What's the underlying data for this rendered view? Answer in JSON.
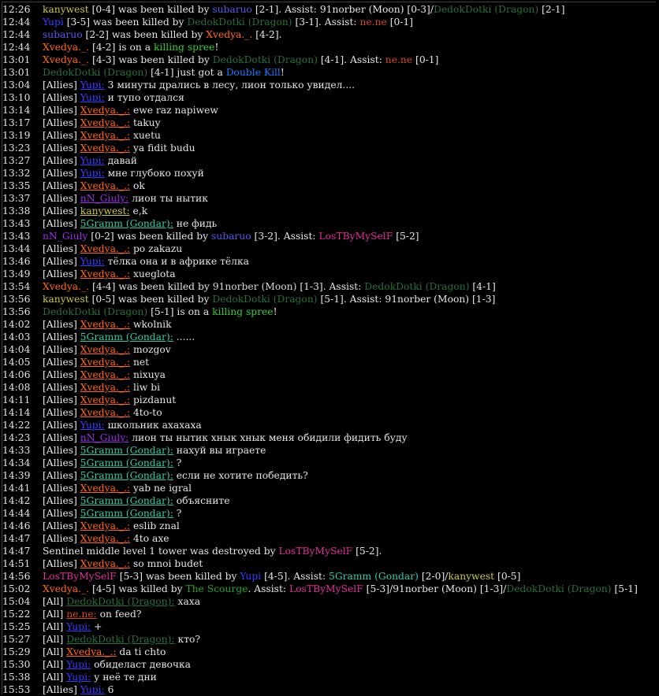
{
  "colors": {
    "white": "#e4e4e4",
    "kanywest": "#c8c850",
    "subaruo": "#5a5ae6",
    "Yupi": "#3c3cff",
    "nene": "#d04a1e",
    "Xvedya": "#ff6a1a",
    "Dedok": "#2a6e3a",
    "spree": "#3ec83e",
    "lime": "#64ff64",
    "doublekill": "#1a7aff",
    "nN": "#9a2ee6",
    "gramm": "#3ac8a8",
    "lost": "#e0309a",
    "scourge": "#2aa02a",
    "norber": "#d8d8d8"
  },
  "lines": [
    {
      "time": "12:26",
      "segs": [
        [
          "kanywest",
          "kanywest"
        ],
        [
          "white",
          " [0-4] was been killed by "
        ],
        [
          "subaruo",
          "subaruo"
        ],
        [
          "white",
          " [2-1]. Assist: 91norber (Moon) [0-3]/"
        ],
        [
          "Dedok",
          "DedokDotki (Dragon)"
        ],
        [
          "white",
          " [2-1]"
        ]
      ]
    },
    {
      "time": "12:44",
      "segs": [
        [
          "Yupi",
          "Yupi"
        ],
        [
          "white",
          " [3-5] was been killed by "
        ],
        [
          "Dedok",
          "DedokDotki (Dragon)"
        ],
        [
          "white",
          " [3-1]. Assist: "
        ],
        [
          "nene",
          "ne.ne"
        ],
        [
          "white",
          " [0-1]"
        ]
      ]
    },
    {
      "time": "12:44",
      "segs": [
        [
          "subaruo",
          "subaruo"
        ],
        [
          "white",
          " [2-2] was been killed by "
        ],
        [
          "Xvedya",
          "Xvedya._."
        ],
        [
          "white",
          " [4-2]."
        ]
      ]
    },
    {
      "time": "12:44",
      "segs": [
        [
          "Xvedya",
          "Xvedya._."
        ],
        [
          "white",
          " [4-2] is on a "
        ],
        [
          "spree",
          "killing spree"
        ],
        [
          "white",
          "!"
        ]
      ]
    },
    {
      "time": "13:01",
      "segs": [
        [
          "Xvedya",
          "Xvedya._."
        ],
        [
          "white",
          " [4-3] was been killed by "
        ],
        [
          "Dedok",
          "DedokDotki (Dragon)"
        ],
        [
          "white",
          " [4-1]. Assist: "
        ],
        [
          "nene",
          "ne.ne"
        ],
        [
          "white",
          " [0-1]"
        ]
      ]
    },
    {
      "time": "13:01",
      "segs": [
        [
          "Dedok",
          "DedokDotki (Dragon)"
        ],
        [
          "white",
          " [4-1] just got a "
        ],
        [
          "doublekill",
          "Double Kill"
        ],
        [
          "white",
          "!"
        ]
      ]
    },
    {
      "time": "13:04",
      "segs": [
        [
          "white",
          "[Allies] "
        ],
        [
          "Yupi",
          "Yupi:",
          "u"
        ],
        [
          "white",
          " 3 минуты дрались в лесу, лион только увидел...."
        ]
      ]
    },
    {
      "time": "13:10",
      "segs": [
        [
          "white",
          "[Allies] "
        ],
        [
          "Yupi",
          "Yupi:",
          "u"
        ],
        [
          "white",
          " и тупо отдался"
        ]
      ]
    },
    {
      "time": "13:14",
      "segs": [
        [
          "white",
          "[Allies] "
        ],
        [
          "Xvedya",
          "Xvedya._.:",
          "u"
        ],
        [
          "white",
          " ewe raz napiwew"
        ]
      ]
    },
    {
      "time": "13:17",
      "segs": [
        [
          "white",
          "[Allies] "
        ],
        [
          "Xvedya",
          "Xvedya._.:",
          "u"
        ],
        [
          "white",
          " takuy"
        ]
      ]
    },
    {
      "time": "13:19",
      "segs": [
        [
          "white",
          "[Allies] "
        ],
        [
          "Xvedya",
          "Xvedya._.:",
          "u"
        ],
        [
          "white",
          " xuetu"
        ]
      ]
    },
    {
      "time": "13:23",
      "segs": [
        [
          "white",
          "[Allies] "
        ],
        [
          "Xvedya",
          "Xvedya._.:",
          "u"
        ],
        [
          "white",
          " ya fidit budu"
        ]
      ]
    },
    {
      "time": "13:27",
      "segs": [
        [
          "white",
          "[Allies] "
        ],
        [
          "Yupi",
          "Yupi:",
          "u"
        ],
        [
          "white",
          " давай"
        ]
      ]
    },
    {
      "time": "13:32",
      "segs": [
        [
          "white",
          "[Allies] "
        ],
        [
          "Yupi",
          "Yupi:",
          "u"
        ],
        [
          "white",
          " мне глубоко похуй"
        ]
      ]
    },
    {
      "time": "13:35",
      "segs": [
        [
          "white",
          "[Allies] "
        ],
        [
          "Xvedya",
          "Xvedya._.:",
          "u"
        ],
        [
          "white",
          " ok"
        ]
      ]
    },
    {
      "time": "13:37",
      "segs": [
        [
          "white",
          "[Allies] "
        ],
        [
          "nN",
          "nN_Giuly:",
          "u"
        ],
        [
          "white",
          " лион ты нытик"
        ]
      ]
    },
    {
      "time": "13:38",
      "segs": [
        [
          "white",
          "[Allies] "
        ],
        [
          "kanywest",
          "kanywest:",
          "u"
        ],
        [
          "white",
          " e,k"
        ]
      ]
    },
    {
      "time": "13:43",
      "segs": [
        [
          "white",
          "[Allies] "
        ],
        [
          "gramm",
          "5Gramm (Gondar):",
          "u"
        ],
        [
          "white",
          " не фидь"
        ]
      ]
    },
    {
      "time": "13:43",
      "segs": [
        [
          "nN",
          "nN_Giuly"
        ],
        [
          "white",
          " [0-2] was been killed by "
        ],
        [
          "subaruo",
          "subaruo"
        ],
        [
          "white",
          " [3-2]. Assist: "
        ],
        [
          "lost",
          "LosTByMySelF"
        ],
        [
          "white",
          " [5-2]"
        ]
      ]
    },
    {
      "time": "13:44",
      "segs": [
        [
          "white",
          "[Allies] "
        ],
        [
          "Xvedya",
          "Xvedya._.:",
          "u"
        ],
        [
          "white",
          " po zakazu"
        ]
      ]
    },
    {
      "time": "13:46",
      "segs": [
        [
          "white",
          "[Allies] "
        ],
        [
          "Yupi",
          "Yupi:",
          "u"
        ],
        [
          "white",
          " тёлка она и в африке тёлка"
        ]
      ]
    },
    {
      "time": "13:49",
      "segs": [
        [
          "white",
          "[Allies] "
        ],
        [
          "Xvedya",
          "Xvedya._.:",
          "u"
        ],
        [
          "white",
          " xueglota"
        ]
      ]
    },
    {
      "time": "13:54",
      "segs": [
        [
          "Xvedya",
          "Xvedya._."
        ],
        [
          "white",
          " [4-4] was been killed by "
        ],
        [
          "norber",
          "91norber (Moon)"
        ],
        [
          "white",
          " [1-3]. Assist: "
        ],
        [
          "Dedok",
          "DedokDotki (Dragon)"
        ],
        [
          "white",
          " [4-1]"
        ]
      ]
    },
    {
      "time": "13:56",
      "segs": [
        [
          "kanywest",
          "kanywest"
        ],
        [
          "white",
          " [0-5] was been killed by "
        ],
        [
          "Dedok",
          "DedokDotki (Dragon)"
        ],
        [
          "white",
          " [5-1]. Assist: 91norber (Moon) [1-3]"
        ]
      ]
    },
    {
      "time": "13:56",
      "segs": [
        [
          "Dedok",
          "DedokDotki (Dragon)"
        ],
        [
          "white",
          " [5-1] is on a "
        ],
        [
          "spree",
          "killing spree"
        ],
        [
          "white",
          "!"
        ]
      ]
    },
    {
      "time": "14:02",
      "segs": [
        [
          "white",
          "[Allies] "
        ],
        [
          "Xvedya",
          "Xvedya._.:",
          "u"
        ],
        [
          "white",
          " wkolnik"
        ]
      ]
    },
    {
      "time": "14:03",
      "segs": [
        [
          "white",
          "[Allies] "
        ],
        [
          "gramm",
          "5Gramm (Gondar):",
          "u"
        ],
        [
          "white",
          " ......"
        ]
      ]
    },
    {
      "time": "14:04",
      "segs": [
        [
          "white",
          "[Allies] "
        ],
        [
          "Xvedya",
          "Xvedya._.:",
          "u"
        ],
        [
          "white",
          " mozgov"
        ]
      ]
    },
    {
      "time": "14:05",
      "segs": [
        [
          "white",
          "[Allies] "
        ],
        [
          "Xvedya",
          "Xvedya._.:",
          "u"
        ],
        [
          "white",
          " net"
        ]
      ]
    },
    {
      "time": "14:06",
      "segs": [
        [
          "white",
          "[Allies] "
        ],
        [
          "Xvedya",
          "Xvedya._.:",
          "u"
        ],
        [
          "white",
          " nixuya"
        ]
      ]
    },
    {
      "time": "14:08",
      "segs": [
        [
          "white",
          "[Allies] "
        ],
        [
          "Xvedya",
          "Xvedya._.:",
          "u"
        ],
        [
          "white",
          " liw bi"
        ]
      ]
    },
    {
      "time": "14:11",
      "segs": [
        [
          "white",
          "[Allies] "
        ],
        [
          "Xvedya",
          "Xvedya._.:",
          "u"
        ],
        [
          "white",
          " pizdanut"
        ]
      ]
    },
    {
      "time": "14:14",
      "segs": [
        [
          "white",
          "[Allies] "
        ],
        [
          "Xvedya",
          "Xvedya._.:",
          "u"
        ],
        [
          "white",
          " 4to-to"
        ]
      ]
    },
    {
      "time": "14:22",
      "segs": [
        [
          "white",
          "[Allies] "
        ],
        [
          "Yupi",
          "Yupi:",
          "u"
        ],
        [
          "white",
          " школьник ахахаха"
        ]
      ]
    },
    {
      "time": "14:23",
      "segs": [
        [
          "white",
          "[Allies] "
        ],
        [
          "nN",
          "nN_Giuly:",
          "u"
        ],
        [
          "white",
          " лион ты нытик хнык хнык меня обидили фидить буду"
        ]
      ]
    },
    {
      "time": "14:33",
      "segs": [
        [
          "white",
          "[Allies] "
        ],
        [
          "gramm",
          "5Gramm (Gondar):",
          "u"
        ],
        [
          "white",
          " нахуй вы играете"
        ]
      ]
    },
    {
      "time": "14:34",
      "segs": [
        [
          "white",
          "[Allies] "
        ],
        [
          "gramm",
          "5Gramm (Gondar):",
          "u"
        ],
        [
          "white",
          " ?"
        ]
      ]
    },
    {
      "time": "14:39",
      "segs": [
        [
          "white",
          "[Allies] "
        ],
        [
          "gramm",
          "5Gramm (Gondar):",
          "u"
        ],
        [
          "white",
          " если не хотите победить?"
        ]
      ]
    },
    {
      "time": "14:41",
      "segs": [
        [
          "white",
          "[Allies] "
        ],
        [
          "Xvedya",
          "Xvedya._.:",
          "u"
        ],
        [
          "white",
          " yab ne igral"
        ]
      ]
    },
    {
      "time": "14:42",
      "segs": [
        [
          "white",
          "[Allies] "
        ],
        [
          "gramm",
          "5Gramm (Gondar):",
          "u"
        ],
        [
          "white",
          " объясните"
        ]
      ]
    },
    {
      "time": "14:44",
      "segs": [
        [
          "white",
          "[Allies] "
        ],
        [
          "gramm",
          "5Gramm (Gondar):",
          "u"
        ],
        [
          "white",
          " ?"
        ]
      ]
    },
    {
      "time": "14:46",
      "segs": [
        [
          "white",
          "[Allies] "
        ],
        [
          "Xvedya",
          "Xvedya._.:",
          "u"
        ],
        [
          "white",
          " eslib znal"
        ]
      ]
    },
    {
      "time": "14:47",
      "segs": [
        [
          "white",
          "[Allies] "
        ],
        [
          "Xvedya",
          "Xvedya._.:",
          "u"
        ],
        [
          "white",
          " 4to axe"
        ]
      ]
    },
    {
      "time": "14:47",
      "segs": [
        [
          "white",
          "Sentinel middle level 1 tower was destroyed by "
        ],
        [
          "lost",
          "LosTByMySelF"
        ],
        [
          "white",
          " [5-2]."
        ]
      ]
    },
    {
      "time": "14:51",
      "segs": [
        [
          "white",
          "[Allies] "
        ],
        [
          "Xvedya",
          "Xvedya._.:",
          "u"
        ],
        [
          "white",
          " so mnoi budet"
        ]
      ]
    },
    {
      "time": "14:56",
      "segs": [
        [
          "lost",
          "LosTByMySelF"
        ],
        [
          "white",
          " [5-3] was been killed by "
        ],
        [
          "Yupi",
          "Yupi"
        ],
        [
          "white",
          " [4-5]. Assist: "
        ],
        [
          "gramm",
          "5Gramm (Gondar)"
        ],
        [
          "white",
          " [2-0]/"
        ],
        [
          "kanywest",
          "kanywest"
        ],
        [
          "white",
          " [0-5]"
        ]
      ]
    },
    {
      "time": "15:02",
      "segs": [
        [
          "Xvedya",
          "Xvedya._."
        ],
        [
          "white",
          " [4-5] was killed by "
        ],
        [
          "scourge",
          "The Scourge"
        ],
        [
          "white",
          ". Assist: "
        ],
        [
          "lost",
          "LosTByMySelF"
        ],
        [
          "white",
          " [5-3]/91norber (Moon) [1-3]/"
        ],
        [
          "Dedok",
          "DedokDotki (Dragon)"
        ],
        [
          "white",
          " [5-1]"
        ]
      ]
    },
    {
      "time": "15:04",
      "segs": [
        [
          "white",
          "[All] "
        ],
        [
          "Dedok",
          "DedokDotki (Dragon):",
          "u"
        ],
        [
          "white",
          " хаха"
        ]
      ]
    },
    {
      "time": "15:22",
      "segs": [
        [
          "white",
          "[All] "
        ],
        [
          "nene",
          "ne.ne:",
          "u"
        ],
        [
          "white",
          " on feed?"
        ]
      ]
    },
    {
      "time": "15:25",
      "segs": [
        [
          "white",
          "[All] "
        ],
        [
          "Yupi",
          "Yupi:",
          "u"
        ],
        [
          "white",
          " +"
        ]
      ]
    },
    {
      "time": "15:27",
      "segs": [
        [
          "white",
          "[All] "
        ],
        [
          "Dedok",
          "DedokDotki (Dragon):",
          "u"
        ],
        [
          "white",
          " кто?"
        ]
      ]
    },
    {
      "time": "15:29",
      "segs": [
        [
          "white",
          "[All] "
        ],
        [
          "Xvedya",
          "Xvedya._.:",
          "u"
        ],
        [
          "white",
          " da ti chto"
        ]
      ]
    },
    {
      "time": "15:30",
      "segs": [
        [
          "white",
          "[All] "
        ],
        [
          "Yupi",
          "Yupi:",
          "u"
        ],
        [
          "white",
          " обиделаст девочка"
        ]
      ]
    },
    {
      "time": "15:38",
      "segs": [
        [
          "white",
          "[All] "
        ],
        [
          "Yupi",
          "Yupi:",
          "u"
        ],
        [
          "white",
          " у неё те дни"
        ]
      ]
    },
    {
      "time": "15:53",
      "segs": [
        [
          "white",
          "[Allies] "
        ],
        [
          "Yupi",
          "Yupi:",
          "u"
        ],
        [
          "white",
          " 6"
        ]
      ]
    }
  ]
}
